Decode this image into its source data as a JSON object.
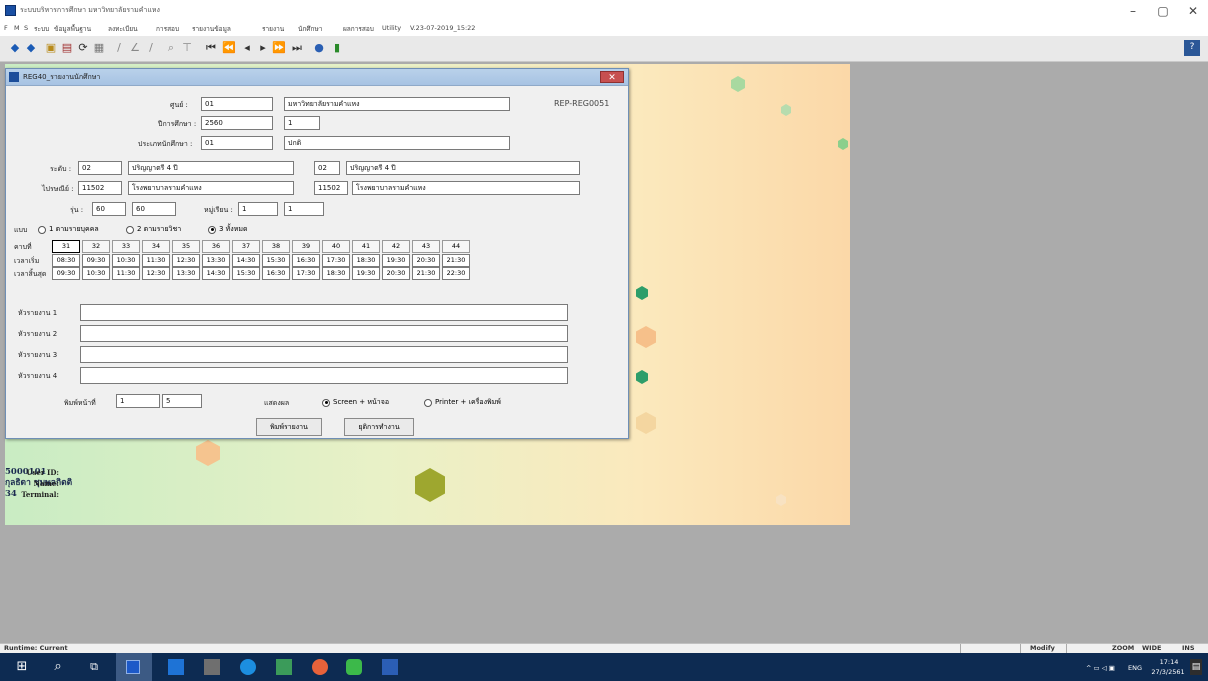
{
  "app": {
    "title": "ระบบบริหารการศึกษา มหาวิทยาลัยรามคำแหง",
    "menu": [
      "F",
      "M",
      "S",
      "ระบบ",
      "ข้อมูลพื้นฐาน",
      "ลงทะเบียน",
      "การสอบ",
      "รายงานข้อมูล",
      "รายงาน",
      "นักศึกษา",
      "ผลการสอบ",
      "Utility",
      "V.23-07-2019_15:22"
    ],
    "window_controls": {
      "minimize": "–",
      "maximize": "▢",
      "close": "✕"
    }
  },
  "dialog": {
    "title": "REG40_รายงานนักศึกษา",
    "report_code": "REP-REG0051",
    "fields": {
      "campus_label": "ศูนย์ :",
      "campus_code": "01",
      "campus_name": "มหาวิทยาลัยรามคำแหง",
      "year_label": "ปีการศึกษา :",
      "year": "2560",
      "semester": "1",
      "student_type_label": "ประเภทนักศึกษา :",
      "student_type_code": "01",
      "student_type_name": "ปกติ",
      "level_label": "ระดับ :",
      "level_from_code": "02",
      "level_from_name": "ปริญญาตรี 4 ปี",
      "level_to_code": "02",
      "level_to_name": "ปริญญาตรี 4 ปี",
      "faculty_label": "ไปรษณีย์ :",
      "faculty_from_code": "11502",
      "faculty_from_name": "โรงพยาบาลรามคำแหง",
      "faculty_to_code": "11502",
      "faculty_to_name": "โรงพยาบาลรามคำแหง",
      "gen_label": "รุ่น :",
      "gen_from": "60",
      "gen_to": "60",
      "group_label": "หมู่เรียน :",
      "group_from": "1",
      "group_to": "1"
    },
    "mode": {
      "label": "แบบ",
      "options": [
        "1 ตามรายบุคคล",
        "2 ตามรายวิชา",
        "3 ทั้งหมด"
      ],
      "selected": 2
    },
    "schedule": {
      "row_labels": [
        "คาบที่",
        "เวลาเริ่ม",
        "เวลาสิ้นสุด"
      ],
      "periods": [
        "31",
        "32",
        "33",
        "34",
        "35",
        "36",
        "37",
        "38",
        "39",
        "40",
        "41",
        "42",
        "43",
        "44"
      ],
      "start_times": [
        "08:30",
        "09:30",
        "10:30",
        "11:30",
        "12:30",
        "13:30",
        "14:30",
        "15:30",
        "16:30",
        "17:30",
        "18:30",
        "19:30",
        "20:30",
        "21:30"
      ],
      "end_times": [
        "09:30",
        "10:30",
        "11:30",
        "12:30",
        "13:30",
        "14:30",
        "15:30",
        "16:30",
        "17:30",
        "18:30",
        "19:30",
        "20:30",
        "21:30",
        "22:30"
      ]
    },
    "remarks": {
      "labels": [
        "หัวรายงาน 1",
        "หัวรายงาน 2",
        "หัวรายงาน 3",
        "หัวรายงาน 4"
      ],
      "values": [
        "",
        "",
        "",
        ""
      ]
    },
    "pages": {
      "label": "พิมพ์หน้าที่",
      "from": "1",
      "to": "5"
    },
    "output": {
      "label": "แสดงผล",
      "options": [
        "Screen + หน้าจอ",
        "Printer + เครื่องพิมพ์"
      ],
      "selected": 0
    },
    "buttons": {
      "print": "พิมพ์รายงาน",
      "cancel": "ยุติการทำงาน"
    }
  },
  "user": {
    "id_label": "User ID:",
    "id": "5000101",
    "name_label": "Name:",
    "name": "กุลธิดา ชุมพลกิตติ",
    "terminal_label": "Terminal:",
    "terminal": "34"
  },
  "statusbar": {
    "runtime": "Runtime: Current",
    "mode": "Modify",
    "zoom": "ZOOM",
    "wide": "WIDE",
    "ins": "INS"
  },
  "taskbar": {
    "lang": "ENG",
    "time": "17:14",
    "date": "27/3/2561"
  },
  "colors": {
    "dialog_close": "#c75050",
    "titlebar": "#b9d1ea",
    "taskbar": "#0d2b52"
  }
}
